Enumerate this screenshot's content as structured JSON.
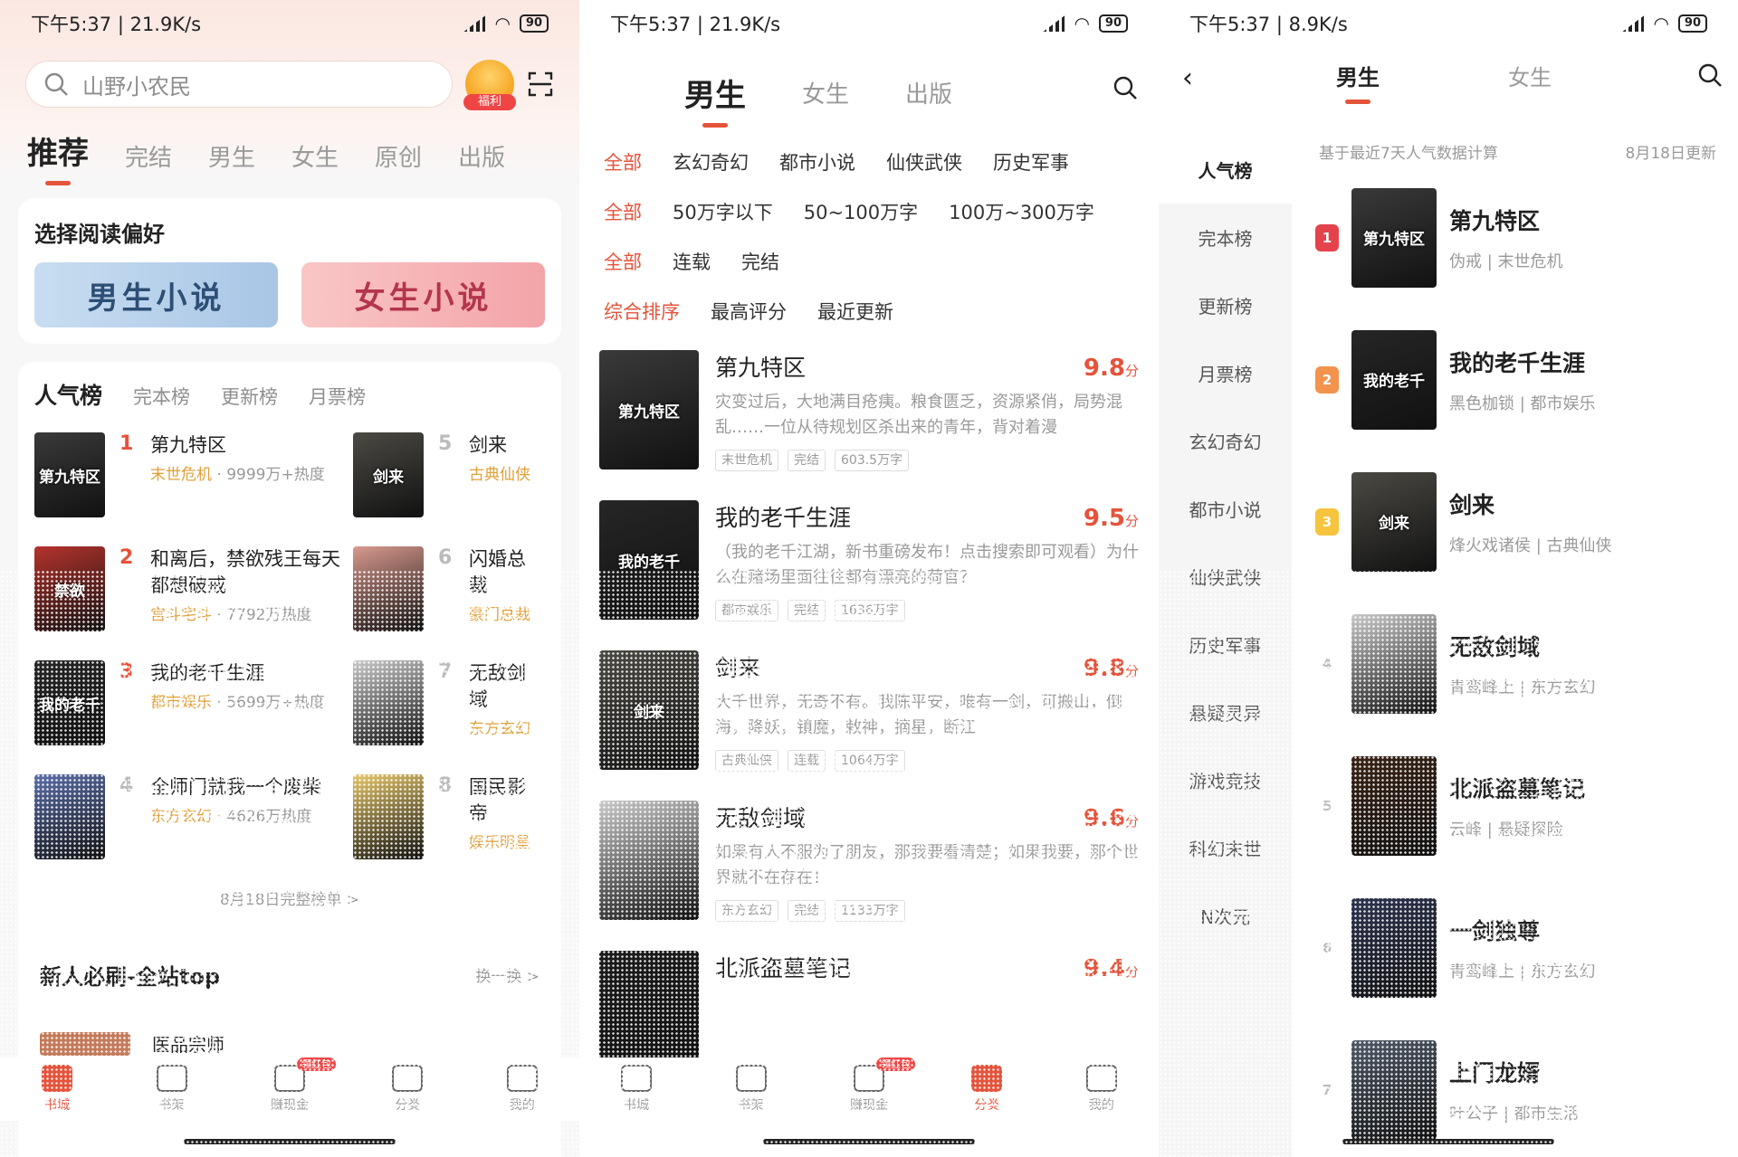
{
  "colors": {
    "accent": "#e5533b",
    "tag": "#e0a03a",
    "muted": "#9a9a9a"
  },
  "panel1": {
    "status": {
      "time": "下午5:37 | 21.9K/s",
      "battery": "90"
    },
    "search": {
      "placeholder": "山野小农民",
      "gift_label": "福利"
    },
    "tabs": [
      "推荐",
      "完结",
      "男生",
      "女生",
      "原创",
      "出版"
    ],
    "preference": {
      "title": "选择阅读偏好",
      "male": "男生小说",
      "female": "女生小说"
    },
    "rank_tabs": [
      "人气榜",
      "完本榜",
      "更新榜",
      "月票榜"
    ],
    "ranks": [
      {
        "no": "1",
        "title": "第九特区",
        "tag": "末世危机",
        "meta": " · 9999万+热度",
        "cover_text": "第九特区",
        "cover_bg": "#3a3a3a"
      },
      {
        "no": "5",
        "title": "剑来",
        "tag": "古典仙侠",
        "meta": "",
        "cover_text": "剑来",
        "cover_bg": "#4b4a44"
      },
      {
        "no": "2",
        "title": "和离后，禁欲残王每天都想破戒",
        "tag": "宫斗宅斗",
        "meta": " · 7792万热度",
        "cover_text": "禁欲",
        "cover_bg": "#b5332c"
      },
      {
        "no": "6",
        "title": "闪婚总裁",
        "tag": "豪门总裁",
        "meta": "",
        "cover_text": "",
        "cover_bg": "#d99a8e"
      },
      {
        "no": "3",
        "title": "我的老千生涯",
        "tag": "都市娱乐",
        "meta": " · 5699万+热度",
        "cover_text": "我的老千",
        "cover_bg": "#262626"
      },
      {
        "no": "7",
        "title": "无敌剑域",
        "tag": "东方玄幻",
        "meta": "",
        "cover_text": "",
        "cover_bg": "#c9c9c9"
      },
      {
        "no": "4",
        "title": "全师门就我一个废柴",
        "tag": "东方玄幻",
        "meta": " · 4626万热度",
        "cover_text": "",
        "cover_bg": "#5b6ea8"
      },
      {
        "no": "8",
        "title": "国民影帝",
        "tag": "娱乐明星",
        "meta": "",
        "cover_text": "",
        "cover_bg": "#e6c76a"
      }
    ],
    "more": "8月18日完整榜单 >",
    "newbie": {
      "title": "新人必刷-全站top",
      "more": "换一换 >",
      "item": "医品宗师"
    },
    "nav": [
      {
        "label": "书城",
        "badge": ""
      },
      {
        "label": "书架",
        "badge": ""
      },
      {
        "label": "赚现金",
        "badge": "领红包"
      },
      {
        "label": "分类",
        "badge": ""
      },
      {
        "label": "我的",
        "badge": ""
      }
    ]
  },
  "panel2": {
    "status": {
      "time": "下午5:37 | 21.9K/s",
      "battery": "90"
    },
    "tabs": [
      "男生",
      "女生",
      "出版"
    ],
    "filters": [
      [
        "全部",
        "玄幻奇幻",
        "都市小说",
        "仙侠武侠",
        "历史军事"
      ],
      [
        "全部",
        "50万字以下",
        "50~100万字",
        "100万~300万字"
      ],
      [
        "全部",
        "连载",
        "完结"
      ],
      [
        "综合排序",
        "最高评分",
        "最近更新"
      ]
    ],
    "books": [
      {
        "title": "第九特区",
        "score": "9.8",
        "unit": "分",
        "desc": "灾变过后，大地满目疮痍。粮食匮乏，资源紧俏，局势混乱……一位从待规划区杀出来的青年，背对着漫",
        "tags": [
          "末世危机",
          "完结",
          "603.5万字"
        ],
        "cover_text": "第九特区",
        "cover_bg": "#3a3a3a"
      },
      {
        "title": "我的老千生涯",
        "score": "9.5",
        "unit": "分",
        "desc": "（我的老千江湖，新书重磅发布！点击搜索即可观看）为什么在赌场里面往往都有漂亮的荷官？",
        "tags": [
          "都市娱乐",
          "完结",
          "1636万字"
        ],
        "cover_text": "我的老千",
        "cover_bg": "#262626"
      },
      {
        "title": "剑来",
        "score": "9.8",
        "unit": "分",
        "desc": "大千世界，无奇不有。我陈平安，唯有一剑，可搬山，倒海，降妖，镇魔，敕神，摘星，断江",
        "tags": [
          "古典仙侠",
          "连载",
          "1064万字"
        ],
        "cover_text": "剑来",
        "cover_bg": "#4b4a44"
      },
      {
        "title": "无敌剑域",
        "score": "9.6",
        "unit": "分",
        "desc": "如果有人不服为了朋友，那我要看清楚；如果我要，那个世界就不在存在！",
        "tags": [
          "东方玄幻",
          "完结",
          "1133万字"
        ],
        "cover_text": "",
        "cover_bg": "#c9c9c9"
      },
      {
        "title": "北派盗墓笔记",
        "score": "9.4",
        "unit": "分",
        "desc": "",
        "tags": [],
        "cover_text": "",
        "cover_bg": "#1c1c1c"
      }
    ],
    "nav": [
      {
        "label": "书城",
        "badge": ""
      },
      {
        "label": "书架",
        "badge": ""
      },
      {
        "label": "赚现金",
        "badge": "领红包"
      },
      {
        "label": "分类",
        "badge": ""
      },
      {
        "label": "我的",
        "badge": ""
      }
    ]
  },
  "panel3": {
    "status": {
      "time": "下午5:37 | 8.9K/s",
      "battery": "90"
    },
    "tabs": [
      "男生",
      "女生"
    ],
    "side": [
      "人气榜",
      "完本榜",
      "更新榜",
      "月票榜",
      "玄幻奇幻",
      "都市小说",
      "仙侠武侠",
      "历史军事",
      "悬疑灵异",
      "游戏竞技",
      "科幻末世",
      "N次元"
    ],
    "note": "基于最近7天人气数据计算",
    "updated": "8月18日更新",
    "list": [
      {
        "no": "1",
        "title": "第九特区",
        "meta": "伪戒 | 末世危机",
        "cover_text": "第九特区",
        "cover_bg": "#3a3a3a"
      },
      {
        "no": "2",
        "title": "我的老千生涯",
        "meta": "黑色枷锁 | 都市娱乐",
        "cover_text": "我的老千",
        "cover_bg": "#262626"
      },
      {
        "no": "3",
        "title": "剑来",
        "meta": "烽火戏诸侯 | 古典仙侠",
        "cover_text": "剑来",
        "cover_bg": "#4b4a44"
      },
      {
        "no": "4",
        "title": "无敌剑域",
        "meta": "青鸾峰上 | 东方玄幻",
        "cover_text": "",
        "cover_bg": "#c9c9c9"
      },
      {
        "no": "5",
        "title": "北派盗墓笔记",
        "meta": "云峰 | 悬疑探险",
        "cover_text": "",
        "cover_bg": "#3a2416"
      },
      {
        "no": "6",
        "title": "一剑独尊",
        "meta": "青鸾峰上 | 东方玄幻",
        "cover_text": "",
        "cover_bg": "#2e3550"
      },
      {
        "no": "7",
        "title": "上门龙婿",
        "meta": "叶公子 | 都市生活",
        "cover_text": "",
        "cover_bg": "#505a68"
      }
    ]
  }
}
